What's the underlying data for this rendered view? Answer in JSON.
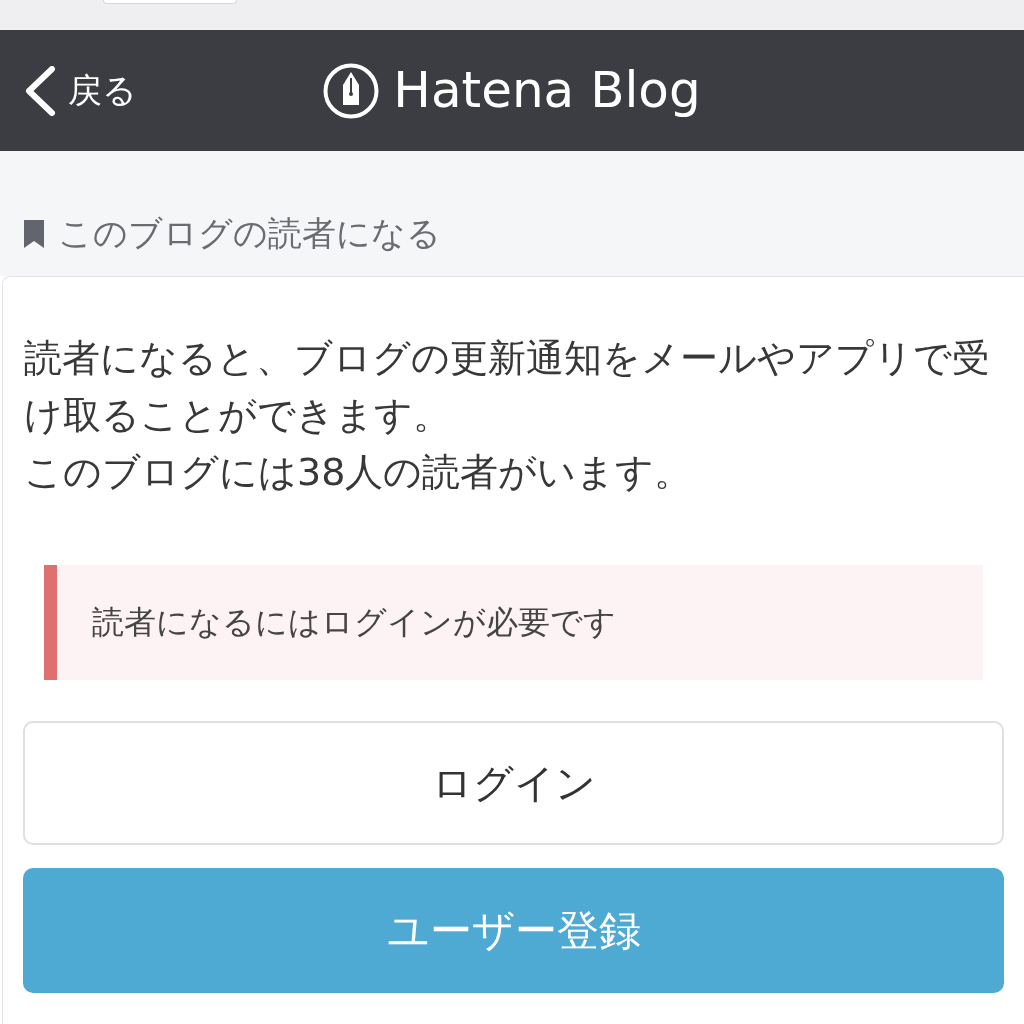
{
  "header": {
    "back_label": "戻る",
    "logo_text": "Hatena Blog"
  },
  "section": {
    "title": "このブログの読者になる"
  },
  "card": {
    "paragraphs": [
      "読者になると、ブログの更新通知をメールやアプリで受け取ることができます。",
      "このブログには38人の読者がいます。"
    ],
    "alert": {
      "message": "読者になるにはログインが必要です"
    },
    "buttons": [
      {
        "kind": "secondary",
        "label": "ログイン"
      },
      {
        "kind": "primary",
        "label": "ユーザー登録"
      }
    ]
  }
}
